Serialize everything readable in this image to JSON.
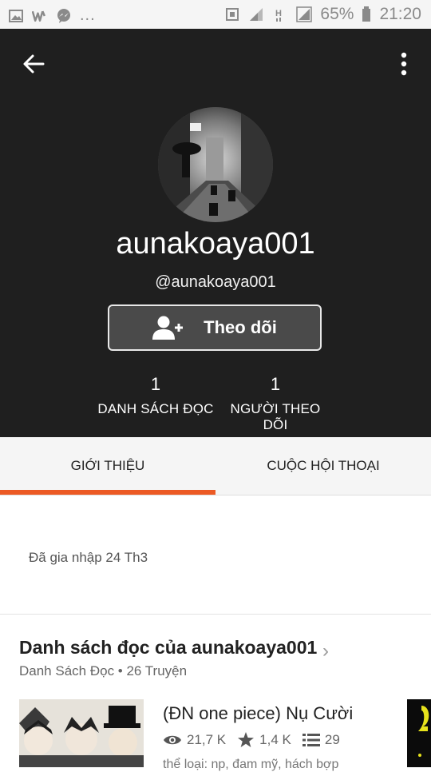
{
  "status_bar": {
    "icons": [
      "image-icon",
      "wattpad-icon",
      "messenger-icon"
    ],
    "more": "...",
    "battery": "65%",
    "time": "21:20"
  },
  "profile": {
    "display_name": "aunakoaya001",
    "handle": "@aunakoaya001",
    "follow_label": "Theo dõi",
    "stats": [
      {
        "value": "1",
        "label": "DANH SÁCH ĐỌC"
      },
      {
        "value": "1",
        "label": "NGƯỜI THEO DÕI"
      }
    ]
  },
  "tabs": [
    {
      "label": "GIỚI THIỆU",
      "active": true
    },
    {
      "label": "CUỘC HỘI THOẠI",
      "active": false
    }
  ],
  "about": {
    "joined": "Đã gia nhập 24 Th3"
  },
  "reading_list": {
    "title": "Danh sách đọc của aunakoaya001",
    "subtitle": "Danh Sách Đọc • 26 Truyện",
    "story": {
      "title": "(ĐN one piece) Nụ Cười",
      "views": "21,7 K",
      "votes": "1,4 K",
      "parts": "29",
      "tags": "thể loại: np, đam mỹ, hách bợp"
    }
  },
  "colors": {
    "header_bg": "#1f1f1f",
    "accent": "#ec5a24",
    "tab_bg": "#f5f5f5"
  }
}
